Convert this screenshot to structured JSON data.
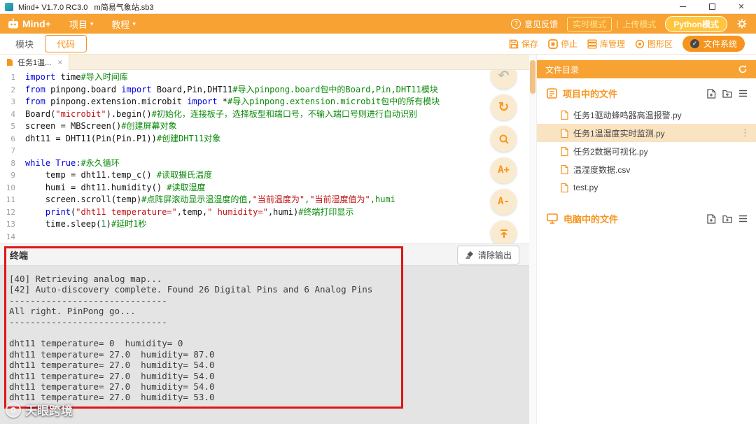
{
  "titlebar": {
    "title": "Mind+ V1.7.0 RC3.0   m简易气象站.sb3",
    "close_glyph": "✕"
  },
  "menubar": {
    "logo_text": "Mind+",
    "menu_project": "项目",
    "menu_tutorial": "教程",
    "caret": "▾",
    "help_glyph": "?",
    "feedback": "意见反馈",
    "mode_realtime": "实时模式",
    "mode_separator": "|",
    "mode_upload": "上传模式",
    "mode_python": "Python模式"
  },
  "toolbar": {
    "tab_modules": "模块",
    "tab_code": "代码",
    "save": "保存",
    "stop": "停止",
    "library": "库管理",
    "graphics": "图形区",
    "filesystem": "文件系统",
    "check_glyph": "✓"
  },
  "editor": {
    "tab_title": "任务1温...",
    "tab_close": "×",
    "undo_glyph": "↶",
    "redo_glyph": "↻",
    "font_increase": "A+",
    "font_decrease": "A-",
    "lines": [
      {
        "n": "1",
        "tokens": [
          [
            "kw",
            "import"
          ],
          [
            "pl",
            " time"
          ],
          [
            "cm",
            "#导入时间库"
          ]
        ]
      },
      {
        "n": "2",
        "tokens": [
          [
            "kw",
            "from"
          ],
          [
            "pl",
            " pinpong.board "
          ],
          [
            "kw",
            "import"
          ],
          [
            "pl",
            " Board,Pin,DHT11"
          ],
          [
            "cm",
            "#导入pinpong.board包中的Board,Pin,DHT11模块"
          ]
        ]
      },
      {
        "n": "3",
        "tokens": [
          [
            "kw",
            "from"
          ],
          [
            "pl",
            " pinpong.extension.microbit "
          ],
          [
            "kw",
            "import"
          ],
          [
            "pl",
            " *"
          ],
          [
            "cm",
            "#导入pinpong.extension.microbit包中的所有模块"
          ]
        ]
      },
      {
        "n": "4",
        "tokens": [
          [
            "pl",
            "Board("
          ],
          [
            "str",
            "\"microbit\""
          ],
          [
            "pl",
            ").begin()"
          ],
          [
            "cm",
            "#初始化，连接板子，选择板型和端口号，不输入端口号则进行自动识别"
          ]
        ]
      },
      {
        "n": "5",
        "tokens": [
          [
            "pl",
            "screen = MBScreen()"
          ],
          [
            "cm",
            "#创建屏幕对象"
          ]
        ]
      },
      {
        "n": "6",
        "tokens": [
          [
            "pl",
            "dht11 = DHT11(Pin(Pin.P1))"
          ],
          [
            "cm",
            "#创建DHT11对象"
          ]
        ]
      },
      {
        "n": "7",
        "tokens": []
      },
      {
        "n": "8",
        "tokens": [
          [
            "kw",
            "while"
          ],
          [
            "pl",
            " "
          ],
          [
            "kw",
            "True"
          ],
          [
            "pl",
            ":"
          ],
          [
            "cm",
            "#永久循环"
          ]
        ]
      },
      {
        "n": "9",
        "tokens": [
          [
            "pl",
            "    temp = dht11.temp_c() "
          ],
          [
            "cm",
            "#读取摄氏温度"
          ]
        ]
      },
      {
        "n": "10",
        "tokens": [
          [
            "pl",
            "    humi = dht11.humidity() "
          ],
          [
            "cm",
            "#读取湿度"
          ]
        ]
      },
      {
        "n": "11",
        "tokens": [
          [
            "pl",
            "    screen.scroll(temp)"
          ],
          [
            "cm",
            "#点阵屏滚动显示温湿度的值,"
          ],
          [
            "str",
            "\"当前温度为\""
          ],
          [
            "cm",
            ","
          ],
          [
            "str",
            "\"当前湿度值为\""
          ],
          [
            "cm",
            ",humi"
          ]
        ]
      },
      {
        "n": "12",
        "tokens": [
          [
            "pl",
            "    "
          ],
          [
            "kw",
            "print"
          ],
          [
            "pl",
            "("
          ],
          [
            "str",
            "\"dht11 temperature=\""
          ],
          [
            "pl",
            ",temp,"
          ],
          [
            "str",
            "\" humidity=\""
          ],
          [
            "pl",
            ",humi)"
          ],
          [
            "cm",
            "#终端打印显示"
          ]
        ]
      },
      {
        "n": "13",
        "tokens": [
          [
            "pl",
            "    time.sleep("
          ],
          [
            "num",
            "1"
          ],
          [
            "pl",
            ")"
          ],
          [
            "cm",
            "#延时1秒"
          ]
        ]
      },
      {
        "n": "14",
        "tokens": []
      }
    ]
  },
  "terminal": {
    "title": "终端",
    "clear_label": "清除输出",
    "lines": [
      "[40] Retrieving analog map...",
      "[42] Auto-discovery complete. Found 26 Digital Pins and 6 Analog Pins",
      "------------------------------",
      "All right. PinPong go...",
      "------------------------------",
      "",
      "dht11 temperature= 0  humidity= 0",
      "dht11 temperature= 27.0  humidity= 87.0",
      "dht11 temperature= 27.0  humidity= 54.0",
      "dht11 temperature= 27.0  humidity= 54.0",
      "dht11 temperature= 27.0  humidity= 54.0",
      "dht11 temperature= 27.0  humidity= 53.0"
    ]
  },
  "sidebar": {
    "header": "文件目录",
    "project_section": "项目中的文件",
    "computer_section": "电脑中的文件",
    "file_menu_glyph": "⋮",
    "project_files": [
      {
        "name": "任务1驱动蜂鸣器高温报警.py",
        "selected": false
      },
      {
        "name": "任务1温湿度实时监测.py",
        "selected": true
      },
      {
        "name": "任务2数据可视化.py",
        "selected": false
      },
      {
        "name": "温湿度数据.csv",
        "selected": false
      },
      {
        "name": "test.py",
        "selected": false
      }
    ]
  },
  "watermark": {
    "text": "天眼跨境"
  },
  "colors": {
    "accent": "#F7941E",
    "menubar_orange": "#F7A233",
    "selected_file_bg": "#FAE3C1",
    "terminal_bg": "#E4E4E4",
    "red_annotation": "#E01515",
    "keyword": "#0000DF",
    "comment": "#0A8A0A",
    "string": "#C01515"
  }
}
